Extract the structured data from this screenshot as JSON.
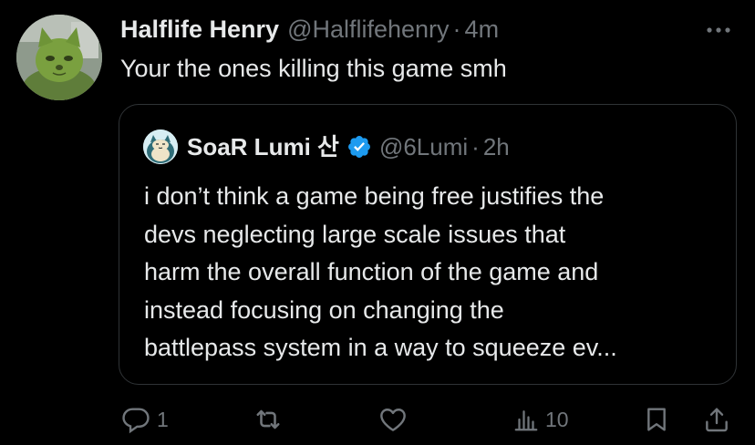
{
  "tweet": {
    "display_name": "Halflife Henry",
    "handle": "@Halflifehenry",
    "separator": "·",
    "time": "4m",
    "text": "Your the ones killing this game smh",
    "avatar_icon": "green-cat-avatar",
    "more_icon": "more-dots-icon"
  },
  "quote": {
    "display_name": "SoaR Lumi 산",
    "verified": true,
    "verified_color": "#1d9bf0",
    "handle": "@6Lumi",
    "separator": "·",
    "time": "2h",
    "avatar_icon": "snorlax-avatar",
    "text_lines": [
      "i don’t think a game being free justifies the",
      "devs neglecting large scale issues that",
      "harm the overall function of the game and",
      "instead focusing on changing the",
      "battlepass system in a way to squeeze ev..."
    ]
  },
  "actions": {
    "reply_count": "1",
    "retweet_count": "",
    "like_count": "",
    "views_count": "10",
    "icons": [
      "reply-icon",
      "retweet-icon",
      "like-icon",
      "views-icon",
      "bookmark-icon",
      "share-icon"
    ]
  },
  "colors": {
    "background": "#000000",
    "text_primary": "#e7e9ea",
    "text_secondary": "#71767b",
    "border": "#2f3336"
  }
}
